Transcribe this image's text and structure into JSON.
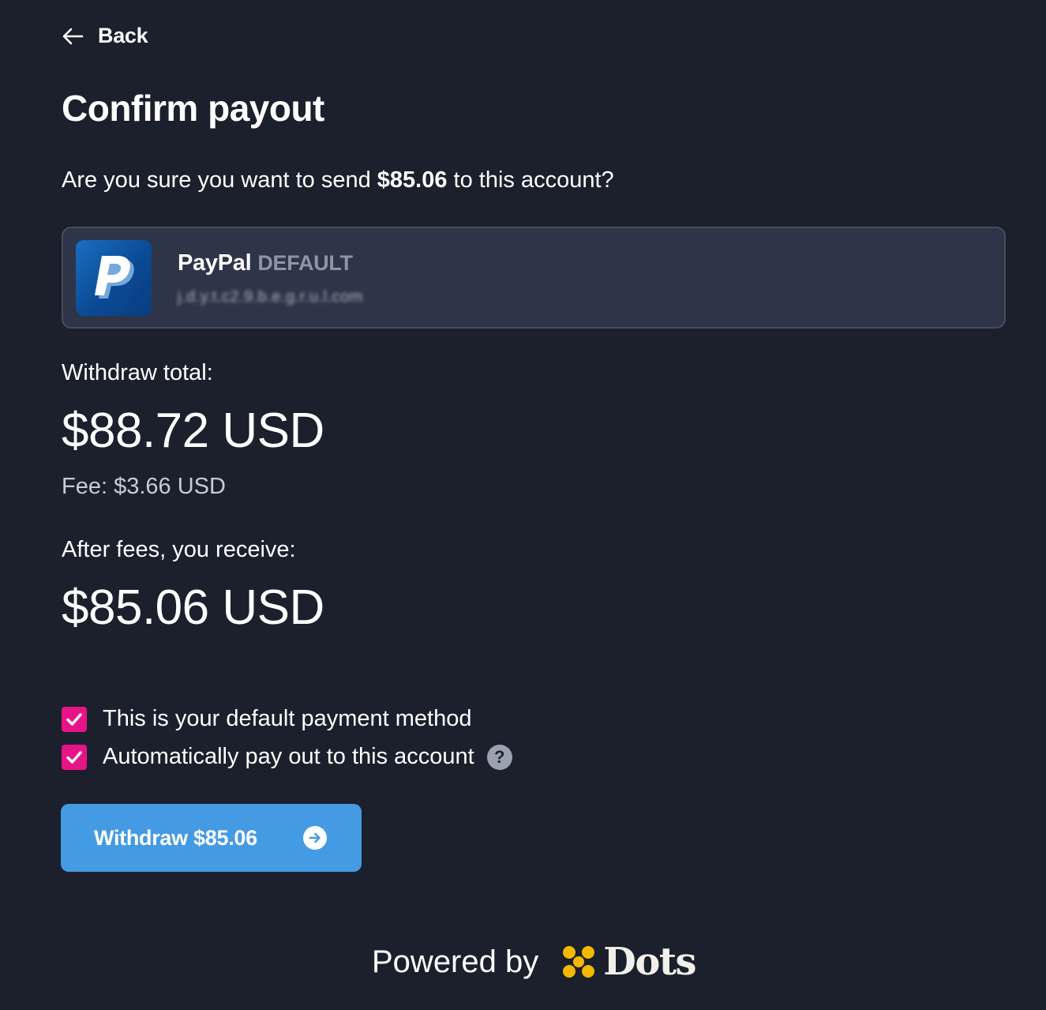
{
  "nav": {
    "back_label": "Back"
  },
  "page": {
    "title": "Confirm payout"
  },
  "question": {
    "prefix": "Are you sure you want to send ",
    "amount": "$85.06",
    "suffix": " to this account?"
  },
  "account": {
    "provider": "PayPal",
    "badge": "DEFAULT",
    "email": "j.d.y.t.c2.9.b.e.g.r.u.l.com",
    "logo_icon": "paypal-icon"
  },
  "withdraw_total": {
    "label": "Withdraw total:",
    "amount": "$88.72 USD",
    "fee": "Fee: $3.66 USD"
  },
  "receive": {
    "label": "After fees, you receive:",
    "amount": "$85.06 USD"
  },
  "options": [
    {
      "label": "This is your default payment method",
      "checked": true
    },
    {
      "label": "Automatically pay out to this account",
      "checked": true,
      "help_icon": "?"
    }
  ],
  "action": {
    "withdraw_label": "Withdraw $85.06",
    "icon": "arrow-right-circle-icon"
  },
  "footer": {
    "powered_by": "Powered by",
    "brand": "Dots"
  },
  "colors": {
    "background": "#1c202c",
    "card": "#2e3548",
    "accent_blue": "#449be3",
    "checkbox_pink": "#e61487",
    "dots_yellow": "#f5b800"
  }
}
